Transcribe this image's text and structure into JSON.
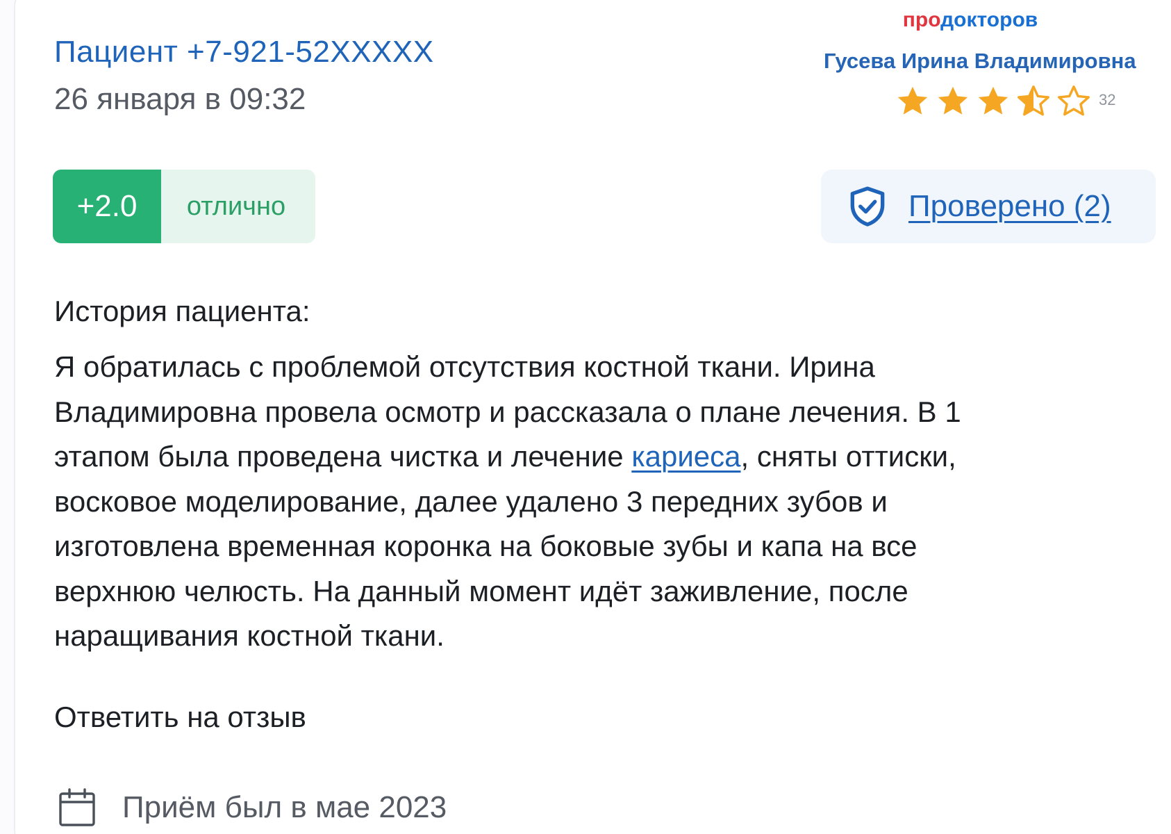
{
  "review": {
    "author": "Пациент +7-921-52XXXXX",
    "date": "26 января в 09:32",
    "score_value": "+2.0",
    "score_label": "отлично",
    "verified_label": "Проверено (2)",
    "section_title": "История пациента:",
    "story_lines": [
      "Я обратилась с проблемой отсутствия костной ткани. Ирина",
      "Владимировна провела осмотр и рассказала о плане лечения. В 1",
      "этапом была проведена чистка и лечение ",
      "кариеса",
      ", сняты оттиски,",
      "восковое моделирование, далее удалено 3 передних зубов и",
      "изготовлена временная коронка на боковые зубы и капа на все",
      "верхнюю челюсть. На данный момент идёт заживление, после",
      "наращивания костной ткани."
    ],
    "reply_label": "Ответить на отзыв",
    "visit_text": "Приём был в мае 2023"
  },
  "widget": {
    "brand_prefix": "про",
    "brand_suffix": "докторов",
    "doctor_name": "Гусева Ирина Владимировна",
    "rating_stars": 3.5,
    "rating_max": 5,
    "review_count": "32"
  },
  "colors": {
    "link": "#1f64b8",
    "score_green": "#27b174",
    "score_bg": "#e6f6ee",
    "star": "#f5a623",
    "brand_red": "#e0363f"
  },
  "icons": {
    "verified": "shield-check-icon",
    "visit": "calendar-icon",
    "rating": "star-icon"
  }
}
